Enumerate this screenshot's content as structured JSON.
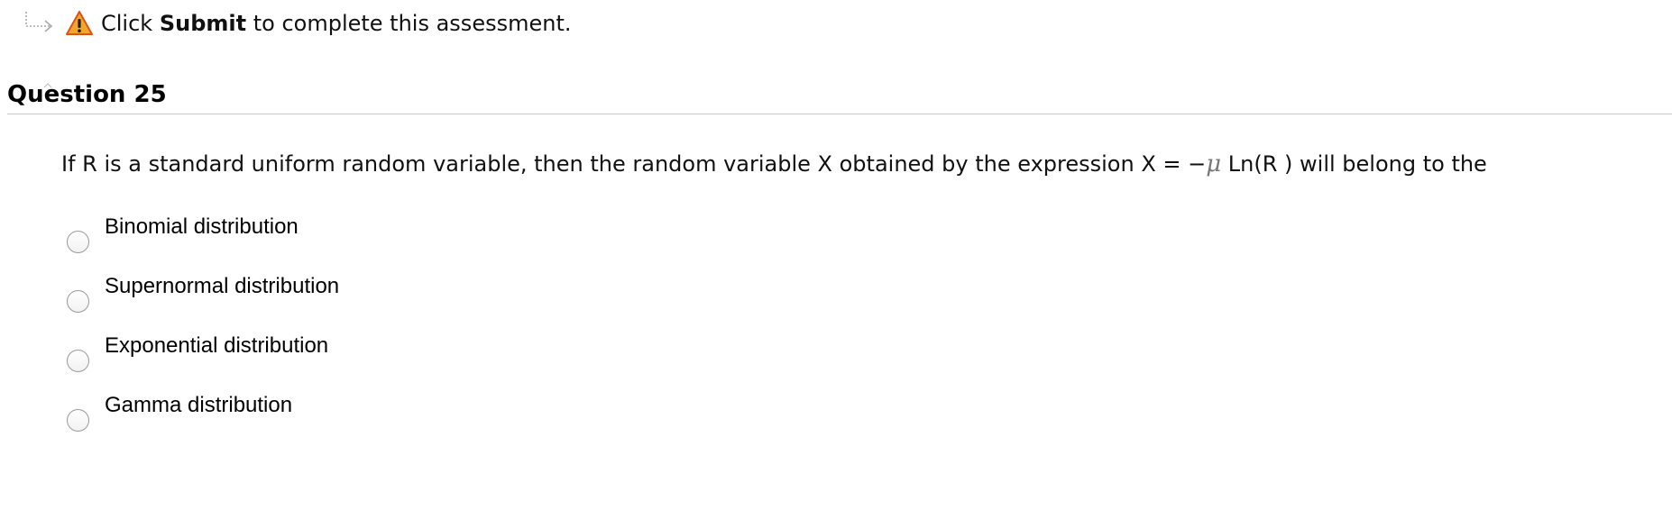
{
  "notice": {
    "prefix": "Click ",
    "bold": "Submit",
    "suffix": " to complete this assessment."
  },
  "question": {
    "title": "Question 25",
    "prompt_before": "If R is a standard uniform random variable, then the random variable X obtained by the expression X = −",
    "prompt_symbol": "μ",
    "prompt_after": " Ln(R ) will belong to the"
  },
  "options": [
    {
      "label": "Binomial distribution",
      "selected": false
    },
    {
      "label": "Supernormal distribution",
      "selected": false
    },
    {
      "label": "Exponential distribution",
      "selected": false
    },
    {
      "label": "Gamma distribution",
      "selected": false
    }
  ],
  "icons": {
    "arrow": "dotted-arrow-icon",
    "warning": "warning-icon"
  },
  "colors": {
    "warning_fill": "#f4a52c",
    "warning_stroke": "#d9541a",
    "divider": "#c8c8c8"
  }
}
